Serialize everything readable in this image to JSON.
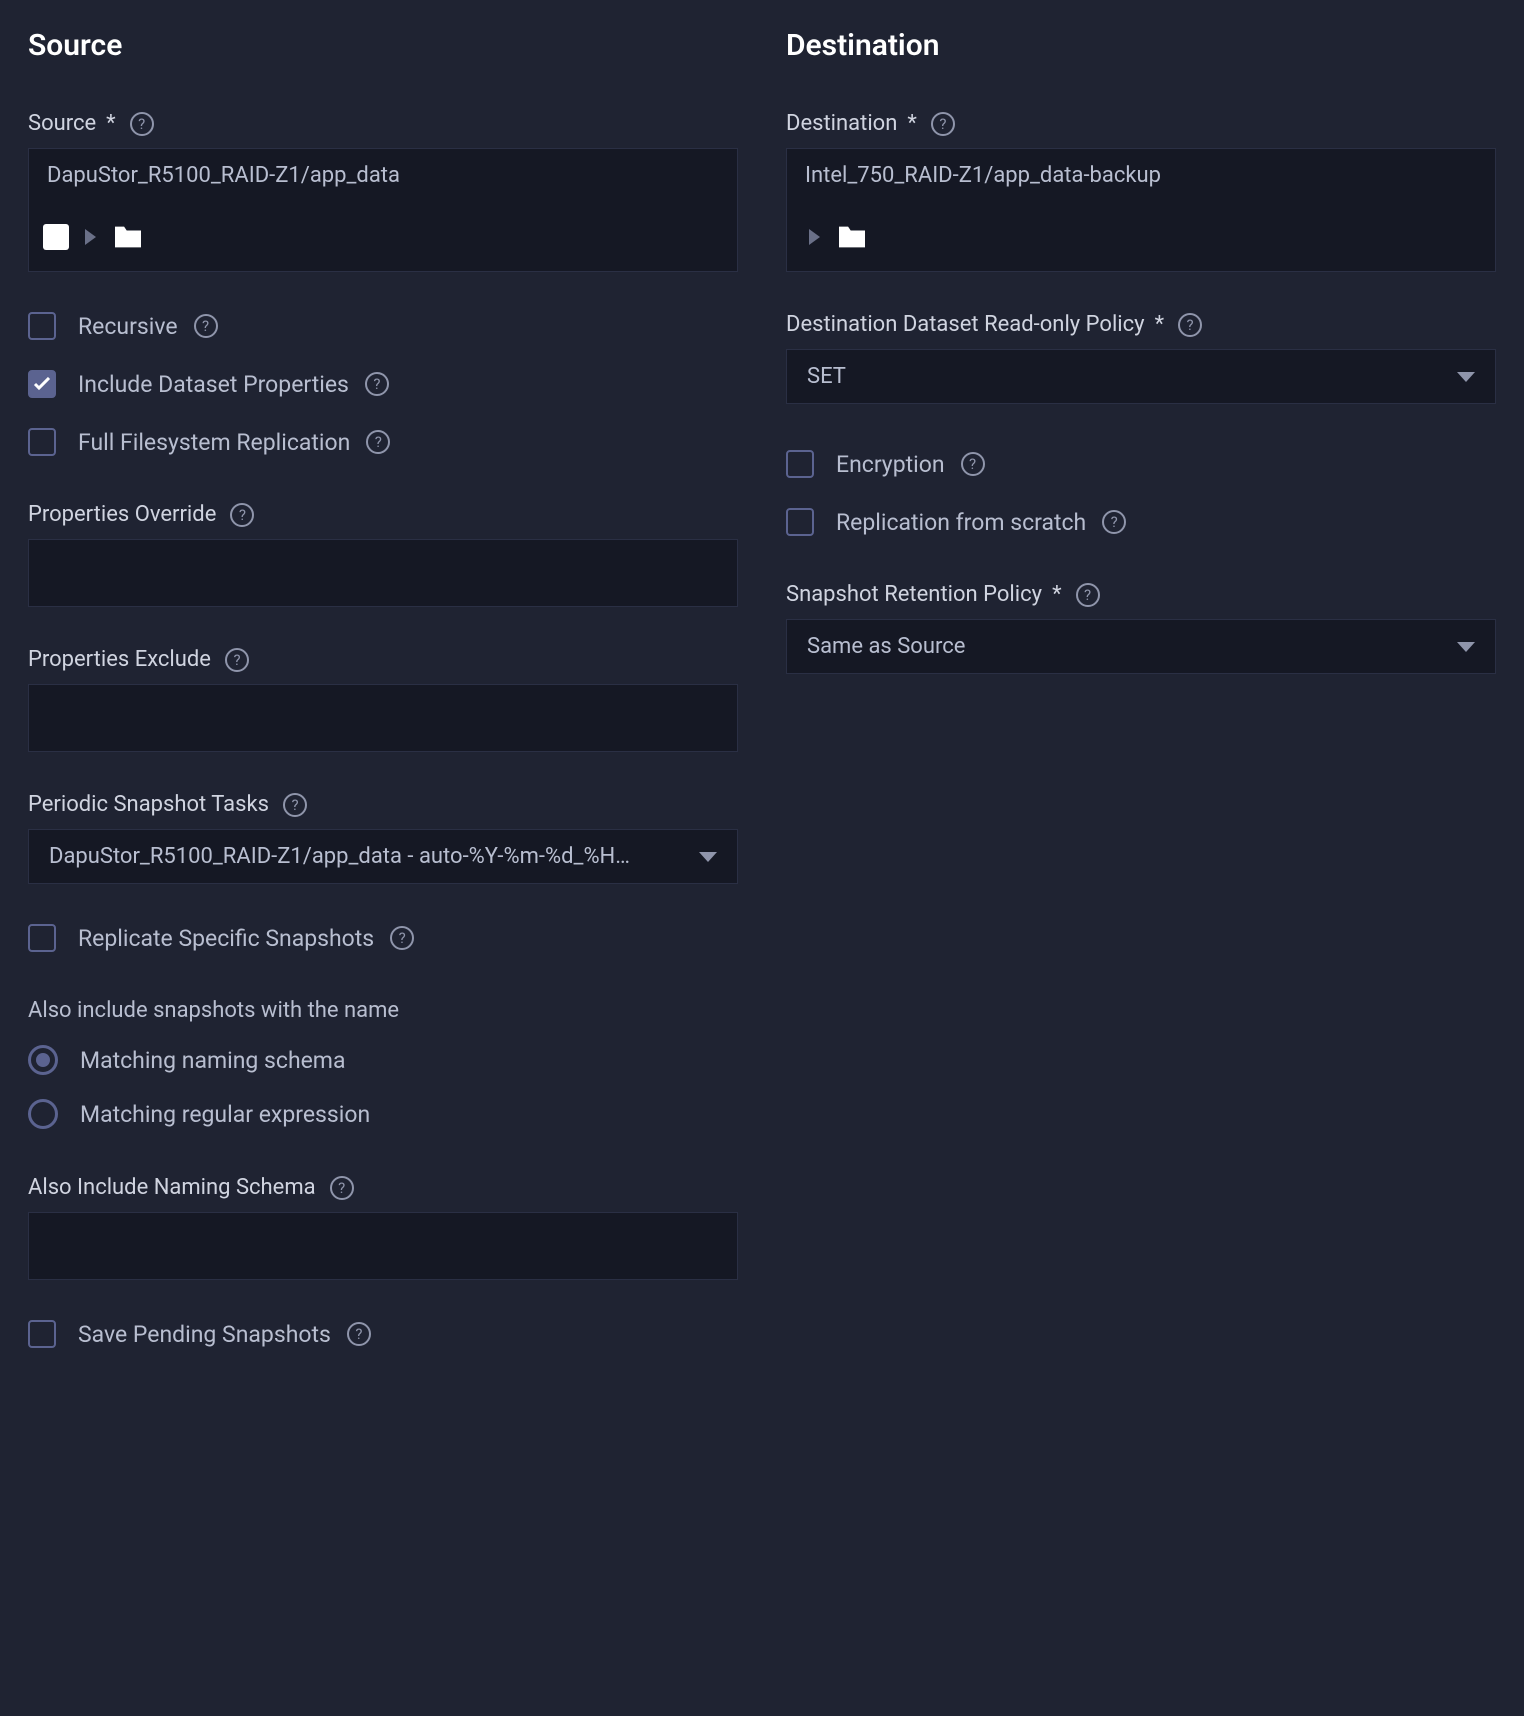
{
  "source": {
    "heading": "Source",
    "source_label": "Source",
    "source_value": "DapuStor_R5100_RAID-Z1/app_data",
    "recursive": "Recursive",
    "include_dataset_props": "Include Dataset Properties",
    "full_fs_replication": "Full Filesystem Replication",
    "properties_override": "Properties Override",
    "properties_exclude": "Properties Exclude",
    "periodic_snapshot_tasks": "Periodic Snapshot Tasks",
    "periodic_value": "DapuStor_R5100_RAID-Z1/app_data - auto-%Y-%m-%d_%H…",
    "replicate_specific": "Replicate Specific Snapshots",
    "also_include_label": "Also include snapshots with the name",
    "radio_schema": "Matching naming schema",
    "radio_regex": "Matching regular expression",
    "also_include_naming_schema": "Also Include Naming Schema",
    "save_pending": "Save Pending Snapshots"
  },
  "destination": {
    "heading": "Destination",
    "destination_label": "Destination",
    "destination_value": "Intel_750_RAID-Z1/app_data-backup",
    "readonly_policy_label": "Destination Dataset Read-only Policy",
    "readonly_policy_value": "SET",
    "encryption": "Encryption",
    "replication_from_scratch": "Replication from scratch",
    "retention_label": "Snapshot Retention Policy",
    "retention_value": "Same as Source"
  }
}
